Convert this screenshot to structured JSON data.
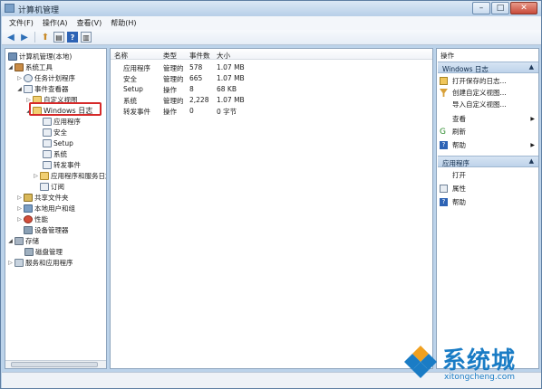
{
  "window": {
    "title": "计算机管理"
  },
  "menu": [
    "文件(F)",
    "操作(A)",
    "查看(V)",
    "帮助(H)"
  ],
  "tree": {
    "root": "计算机管理(本地)",
    "system_tools": "系统工具",
    "task_scheduler": "任务计划程序",
    "event_viewer": "事件查看器",
    "custom_views": "自定义视图",
    "windows_logs": "Windows 日志",
    "app_log": "应用程序",
    "security_log": "安全",
    "setup_log": "Setup",
    "system_log": "系统",
    "forwarded_log": "转发事件",
    "app_service_logs": "应用程序和服务日志",
    "subscriptions": "订阅",
    "shared_folders": "共享文件夹",
    "local_users": "本地用户和组",
    "performance": "性能",
    "device_manager": "设备管理器",
    "storage": "存储",
    "disk_management": "磁盘管理",
    "services_apps": "服务和应用程序"
  },
  "list": {
    "columns": [
      "名称",
      "类型",
      "事件数",
      "大小"
    ],
    "rows": [
      [
        "应用程序",
        "管理的",
        "578",
        "1.07 MB"
      ],
      [
        "安全",
        "管理的",
        "665",
        "1.07 MB"
      ],
      [
        "Setup",
        "操作",
        "8",
        "68 KB"
      ],
      [
        "系统",
        "管理的",
        "2,228",
        "1.07 MB"
      ],
      [
        "转发事件",
        "操作",
        "0",
        "0 字节"
      ]
    ]
  },
  "actions": {
    "title": "操作",
    "section1": "Windows 日志",
    "items1": [
      "打开保存的日志...",
      "创建自定义视图...",
      "导入自定义视图...",
      "查看",
      "刷新",
      "帮助"
    ],
    "section2": "应用程序",
    "items2": [
      "打开",
      "属性",
      "帮助"
    ]
  },
  "watermark": {
    "text": "系统城",
    "sub": "xitongcheng.com"
  }
}
